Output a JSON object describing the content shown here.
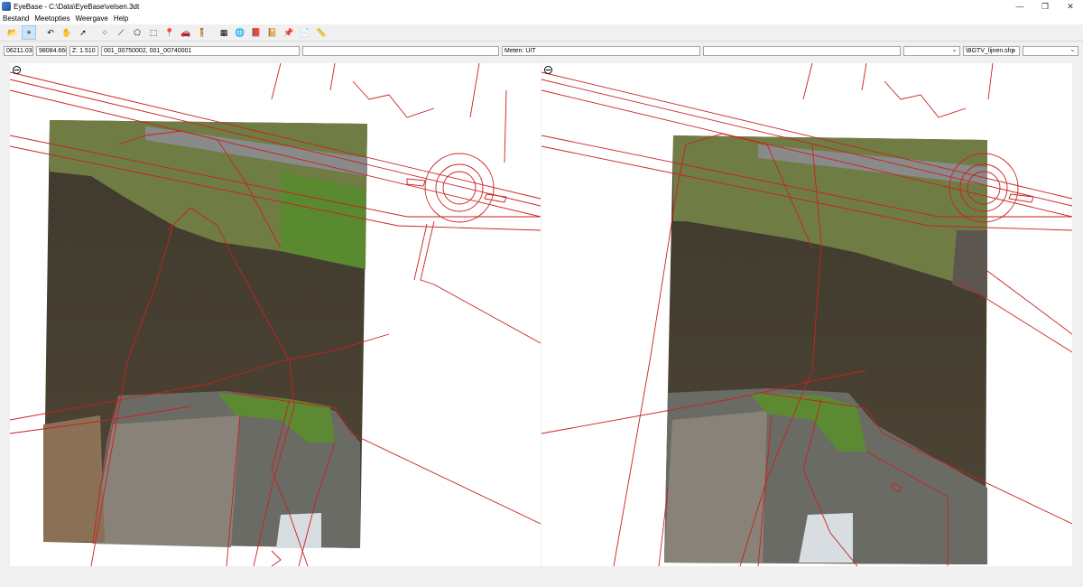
{
  "window": {
    "title": "EyeBase - C:\\Data\\EyeBase\\velsen.3dt",
    "minimize": "—",
    "restore": "❐",
    "close": "✕"
  },
  "menu": [
    "Bestand",
    "Meetopties",
    "Weergave",
    "Help"
  ],
  "toolbar": [
    {
      "icon": "open-folder-icon",
      "glyph": "📂",
      "active": false
    },
    {
      "icon": "crosshair-icon",
      "glyph": "+",
      "active": true
    },
    {
      "icon": "undo-icon",
      "glyph": "↶",
      "active": false
    },
    {
      "icon": "hand-icon",
      "glyph": "✋",
      "active": false
    },
    {
      "icon": "move-arrow-icon",
      "glyph": "➚",
      "active": false
    },
    {
      "icon": "point-icon",
      "glyph": "⁘",
      "active": false
    },
    {
      "icon": "line-icon",
      "glyph": "⟋",
      "active": false
    },
    {
      "icon": "polygon-icon",
      "glyph": "⬠",
      "active": false
    },
    {
      "icon": "dashed-shape-icon",
      "glyph": "⬚",
      "active": false
    },
    {
      "icon": "pin-icon",
      "glyph": "📍",
      "active": false
    },
    {
      "icon": "vehicle-icon",
      "glyph": "🚗",
      "active": false
    },
    {
      "icon": "person-icon",
      "glyph": "🧍",
      "active": false
    },
    {
      "icon": "layers-icon",
      "glyph": "▦",
      "active": false
    },
    {
      "icon": "globe-icon",
      "glyph": "🌐",
      "active": false
    },
    {
      "icon": "book-icon",
      "glyph": "📕",
      "active": false
    },
    {
      "icon": "book-purple-icon",
      "glyph": "📔",
      "active": false
    },
    {
      "icon": "map-pin-icon",
      "glyph": "📌",
      "active": false
    },
    {
      "icon": "document-icon",
      "glyph": "📄",
      "active": false
    },
    {
      "icon": "ruler-icon",
      "glyph": "📏",
      "active": false
    }
  ],
  "status": {
    "x": "06211.030",
    "y": "98084.660",
    "z": "Z: 1.510",
    "photos": "001_00750002, 001_00740001",
    "empty1": "",
    "meten": "Meten: UIT",
    "empty2": "",
    "dropdown1": "",
    "layer": "\\BGTV_lijnen.shp",
    "dropdown3": ""
  },
  "colors": {
    "vector_lines": "#cc1f1f",
    "water": "#4a3f30",
    "grass": "#5f7a35"
  }
}
